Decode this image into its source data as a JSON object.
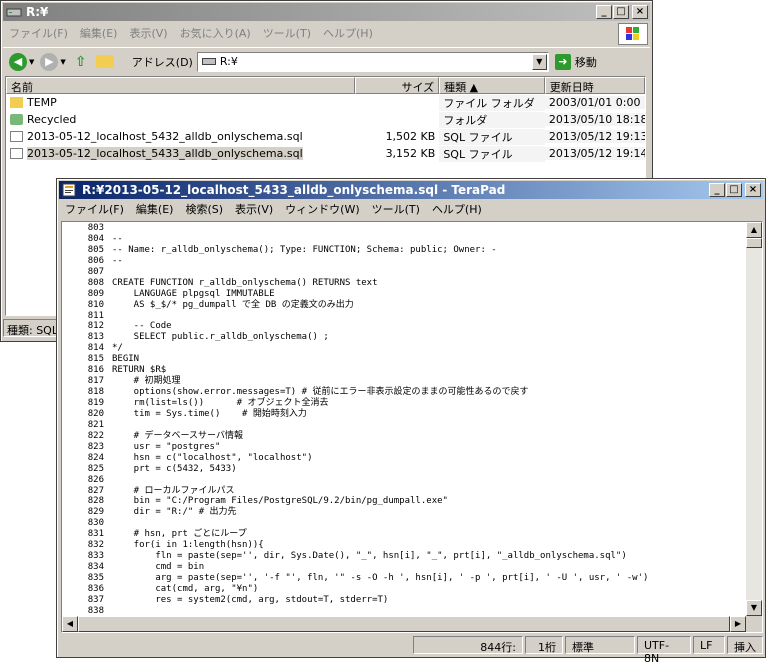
{
  "explorer": {
    "title": "R:¥",
    "menu": [
      "ファイル(F)",
      "編集(E)",
      "表示(V)",
      "お気に入り(A)",
      "ツール(T)",
      "ヘルプ(H)"
    ],
    "address_label": "アドレス(D)",
    "address_value": "R:¥",
    "go_label": "移動",
    "columns": [
      "名前",
      "サイズ",
      "種類 ▲",
      "更新日時"
    ],
    "files": [
      {
        "name": "TEMP",
        "size": "",
        "type": "ファイル フォルダ",
        "date": "2003/01/01 0:00",
        "icon": "folder-icon"
      },
      {
        "name": "Recycled",
        "size": "",
        "type": "フォルダ",
        "date": "2013/05/10 18:18",
        "icon": "recycle-bin-icon"
      },
      {
        "name": "2013-05-12_localhost_5432_alldb_onlyschema.sql",
        "size": "1,502 KB",
        "type": "SQL ファイル",
        "date": "2013/05/12 19:13",
        "icon": "sql-file-icon"
      },
      {
        "name": "2013-05-12_localhost_5433_alldb_onlyschema.sql",
        "size": "3,152 KB",
        "type": "SQL ファイル",
        "date": "2013/05/12 19:14",
        "icon": "sql-file-icon"
      }
    ],
    "status": "種類: SQL"
  },
  "terapad": {
    "title": "R:¥2013-05-12_localhost_5433_alldb_onlyschema.sql - TeraPad",
    "menu": [
      "ファイル(F)",
      "編集(E)",
      "検索(S)",
      "表示(V)",
      "ウィンドウ(W)",
      "ツール(T)",
      "ヘルプ(H)"
    ],
    "lines": [
      {
        "n": "803",
        "t": ""
      },
      {
        "n": "804",
        "t": "--"
      },
      {
        "n": "805",
        "t": "-- Name: r_alldb_onlyschema(); Type: FUNCTION; Schema: public; Owner: -"
      },
      {
        "n": "806",
        "t": "--"
      },
      {
        "n": "807",
        "t": ""
      },
      {
        "n": "808",
        "t": "CREATE FUNCTION r_alldb_onlyschema() RETURNS text"
      },
      {
        "n": "809",
        "t": "    LANGUAGE plpgsql IMMUTABLE"
      },
      {
        "n": "810",
        "t": "    AS $_$/* pg_dumpall で全 DB の定義文のみ出力"
      },
      {
        "n": "811",
        "t": ""
      },
      {
        "n": "812",
        "t": "    -- Code"
      },
      {
        "n": "813",
        "t": "    SELECT public.r_alldb_onlyschema() ;"
      },
      {
        "n": "814",
        "t": "*/"
      },
      {
        "n": "815",
        "t": "BEGIN"
      },
      {
        "n": "816",
        "t": "RETURN $R$"
      },
      {
        "n": "817",
        "t": "    # 初期処理"
      },
      {
        "n": "818",
        "t": "    options(show.error.messages=T) # 従前にエラー非表示設定のままの可能性あるので戻す"
      },
      {
        "n": "819",
        "t": "    rm(list=ls())      # オブジェクト全消去"
      },
      {
        "n": "820",
        "t": "    tim = Sys.time()    # 開始時刻入力"
      },
      {
        "n": "821",
        "t": ""
      },
      {
        "n": "822",
        "t": "    # データベースサーバ情報"
      },
      {
        "n": "823",
        "t": "    usr = \"postgres\""
      },
      {
        "n": "824",
        "t": "    hsn = c(\"localhost\", \"localhost\")"
      },
      {
        "n": "825",
        "t": "    prt = c(5432, 5433)"
      },
      {
        "n": "826",
        "t": ""
      },
      {
        "n": "827",
        "t": "    # ローカルファイルパス"
      },
      {
        "n": "828",
        "t": "    bin = \"C:/Program Files/PostgreSQL/9.2/bin/pg_dumpall.exe\""
      },
      {
        "n": "829",
        "t": "    dir = \"R:/\" # 出力先"
      },
      {
        "n": "830",
        "t": ""
      },
      {
        "n": "831",
        "t": "    # hsn, prt ごとにループ"
      },
      {
        "n": "832",
        "t": "    for(i in 1:length(hsn)){"
      },
      {
        "n": "833",
        "t": "        fln = paste(sep='', dir, Sys.Date(), \"_\", hsn[i], \"_\", prt[i], \"_alldb_onlyschema.sql\")"
      },
      {
        "n": "834",
        "t": "        cmd = bin"
      },
      {
        "n": "835",
        "t": "        arg = paste(sep='', '-f \"', fln, '\" -s -O -h ', hsn[i], ' -p ', prt[i], ' -U ', usr, ' -w')"
      },
      {
        "n": "836",
        "t": "        cat(cmd, arg, \"¥n\")"
      },
      {
        "n": "837",
        "t": "        res = system2(cmd, arg, stdout=T, stderr=T)"
      },
      {
        "n": "838",
        "t": ""
      }
    ],
    "status": {
      "line": "844行:",
      "col": "1桁",
      "mode": "標準",
      "encoding": "UTF-8N",
      "newline": "LF",
      "insert": "挿入"
    }
  }
}
